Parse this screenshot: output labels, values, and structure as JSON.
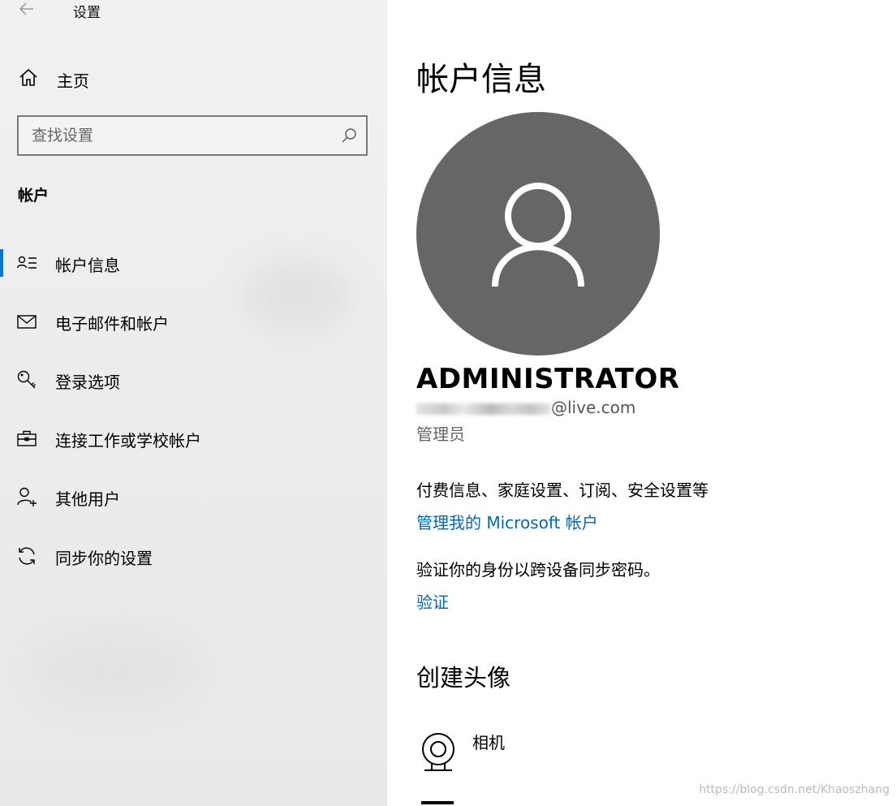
{
  "window": {
    "title": "设置"
  },
  "sidebar": {
    "home_label": "主页",
    "search_placeholder": "查找设置",
    "section_title": "帐户",
    "items": [
      {
        "label": "帐户信息",
        "icon": "account-info-icon",
        "active": true
      },
      {
        "label": "电子邮件和帐户",
        "icon": "mail-icon",
        "active": false
      },
      {
        "label": "登录选项",
        "icon": "key-icon",
        "active": false
      },
      {
        "label": "连接工作或学校帐户",
        "icon": "briefcase-icon",
        "active": false
      },
      {
        "label": "其他用户",
        "icon": "add-person-icon",
        "active": false
      },
      {
        "label": "同步你的设置",
        "icon": "sync-icon",
        "active": false
      }
    ]
  },
  "main": {
    "title": "帐户信息",
    "user_name": "ADMINISTRATOR",
    "email_domain": "@live.com",
    "role": "管理员",
    "billing_text": "付费信息、家庭设置、订阅、安全设置等",
    "manage_link": "管理我的 Microsoft 帐户",
    "verify_text": "验证你的身份以跨设备同步密码。",
    "verify_link": "验证",
    "create_avatar_title": "创建头像",
    "camera_label": "相机"
  },
  "watermark": "https://blog.csdn.net/Khaoszhang",
  "colors": {
    "accent": "#0078d7",
    "link": "#0067b8",
    "avatar_bg": "#666666"
  }
}
